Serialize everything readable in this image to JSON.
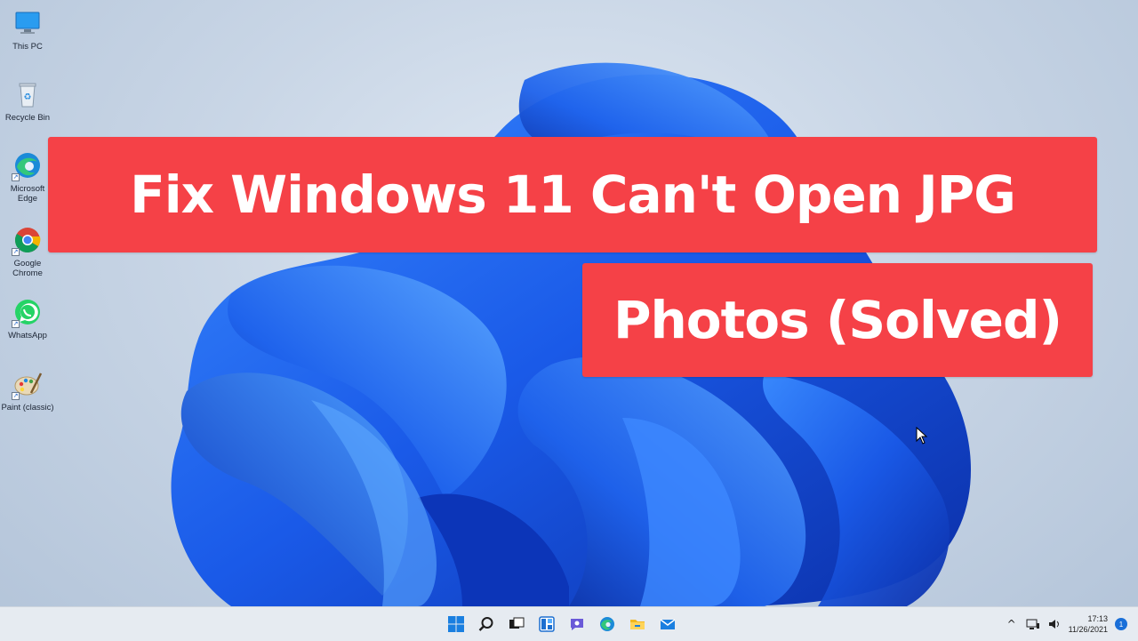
{
  "desktop": {
    "icons": [
      {
        "label": "This PC"
      },
      {
        "label": "Recycle Bin"
      },
      {
        "label": "Microsoft Edge"
      },
      {
        "label": "Google Chrome"
      },
      {
        "label": "WhatsApp"
      },
      {
        "label": "Paint (classic)"
      }
    ]
  },
  "overlay": {
    "title_line_1": "Fix Windows 11 Can't Open JPG",
    "title_line_2": "Photos (Solved)",
    "banner_color": "#f54147"
  },
  "taskbar": {
    "pinned": [
      "start-icon",
      "search-icon",
      "task-view-icon",
      "widgets-icon",
      "chat-icon",
      "edge-icon",
      "file-explorer-icon",
      "mail-icon"
    ],
    "tray": {
      "chevron": "^",
      "time": "17:13",
      "date": "11/26/2021",
      "notifications": "1"
    }
  },
  "colors": {
    "accent": "#1a6fd8",
    "wallpaper_bloom": "#1f5fe0"
  }
}
